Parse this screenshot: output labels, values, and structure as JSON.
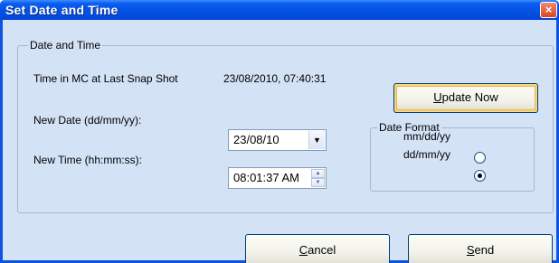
{
  "window": {
    "title": "Set Date and Time",
    "close_glyph": "×"
  },
  "group_datetime": {
    "legend": "Date and Time",
    "last_snapshot_label": "Time in MC at Last Snap Shot",
    "last_snapshot_value": "23/08/2010, 07:40:31",
    "update_button": {
      "mnemonic": "U",
      "rest": "pdate Now"
    },
    "new_date_label": "New Date (dd/mm/yy):",
    "new_date_value": "23/08/10",
    "new_time_label": "New Time (hh:mm:ss):",
    "new_time_value": "08:01:37 AM"
  },
  "group_dateformat": {
    "legend": "Date Format",
    "options": [
      {
        "label": "mm/dd/yy",
        "checked": false
      },
      {
        "label": "dd/mm/yy",
        "checked": true
      }
    ]
  },
  "footer": {
    "cancel_button": {
      "mnemonic": "C",
      "rest": "ancel"
    },
    "send_button": {
      "mnemonic": "S",
      "rest": "end"
    }
  },
  "colors": {
    "titlebar": "#0351e3",
    "client_bg": "#d4e2f6",
    "button_border": "#003c74",
    "focus_highlight": "#f8d77e"
  },
  "icons": {
    "close": "close-icon",
    "dropdown": "chevron-down-icon",
    "spin_up": "spin-up-icon",
    "spin_down": "spin-down-icon"
  }
}
